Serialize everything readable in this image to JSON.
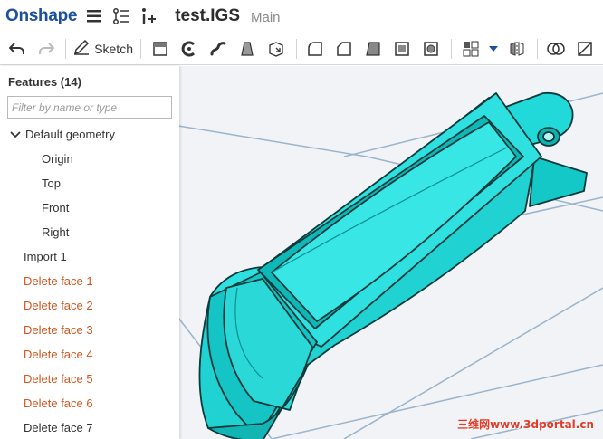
{
  "app": {
    "logo": "Onshape"
  },
  "document": {
    "title": "test.IGS",
    "workspace": "Main"
  },
  "toolbar": {
    "sketch_label": "Sketch",
    "tools": [
      "undo-icon",
      "redo-icon",
      "sketch-pencil-icon",
      "extrude-icon",
      "revolve-icon",
      "sweep-icon",
      "loft-icon",
      "thicken-icon",
      "fillet-icon",
      "chamfer-icon",
      "draft-icon",
      "shell-icon",
      "hole-icon",
      "pattern-icon",
      "mirror-icon",
      "boolean-icon"
    ]
  },
  "panel": {
    "title": "Features (14)",
    "filter_placeholder": "Filter by name or type",
    "items": [
      {
        "label": "Default geometry",
        "kind": "group"
      },
      {
        "label": "Origin",
        "kind": "child"
      },
      {
        "label": "Top",
        "kind": "child"
      },
      {
        "label": "Front",
        "kind": "child"
      },
      {
        "label": "Right",
        "kind": "child"
      },
      {
        "label": "Import 1",
        "kind": "top"
      },
      {
        "label": "Delete face 1",
        "kind": "deleted"
      },
      {
        "label": "Delete face 2",
        "kind": "deleted"
      },
      {
        "label": "Delete face 3",
        "kind": "deleted"
      },
      {
        "label": "Delete face 4",
        "kind": "deleted"
      },
      {
        "label": "Delete face 5",
        "kind": "deleted"
      },
      {
        "label": "Delete face 6",
        "kind": "deleted"
      },
      {
        "label": "Delete face 7",
        "kind": "top"
      }
    ]
  },
  "viewport": {
    "watermark": "三维网www.3dportal.cn"
  },
  "colors": {
    "brand": "#1c4f9c",
    "model": "#19dada",
    "deleted_feature": "#d4541d"
  }
}
